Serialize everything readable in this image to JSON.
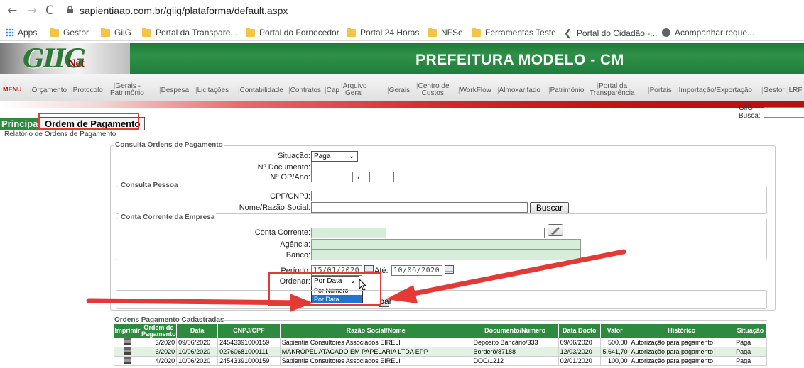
{
  "browser": {
    "url": "sapientiaap.com.br/giig/plataforma/default.aspx",
    "bookmarks": [
      "Apps",
      "Gestor",
      "GiiG",
      "Portal da Transpare...",
      "Portal do Fornecedor",
      "Portal 24 Horas",
      "NFSe",
      "Ferramentas Teste",
      "Portal do Cidadão -...",
      "Acompanhar reque..."
    ]
  },
  "header": {
    "logo_main": "GIIG",
    "logo_sub": "Net",
    "title": "PREFEITURA MODELO - CM"
  },
  "menu": {
    "label": "MENU",
    "items": [
      "Orçamento",
      "Protocolo",
      "Gerais -",
      "Patrimônio",
      "Despesa",
      "Licitações",
      "Contabilidade",
      "Contratos",
      "Cap",
      "Arquivo",
      "Geral",
      "Gerais",
      "Centro de",
      "Custos",
      "WorkFlow",
      "Almoxarifado",
      "Patrimônio",
      "Portal da",
      "Transparência",
      "Portais",
      "Importação/Exportação",
      "Gestor",
      "LRF"
    ]
  },
  "search": {
    "label": "GiiG Busca:"
  },
  "tabs": {
    "principal": "Principal",
    "ordem": "Ordem de Pagamento"
  },
  "subtitle": "Relatório de Ordens de Pagamento",
  "consulta": {
    "legend": "Consulta Ordens de Pagamento",
    "situacao_label": "Situação:",
    "situacao_value": "Paga",
    "documento_label": "Nº Documento:",
    "op_label": "Nº OP/Ano:",
    "op_sep": "/"
  },
  "pessoa": {
    "legend": "Consulta Pessoa",
    "cpf_label": "CPF/CNPJ:",
    "nome_label": "Nome/Razão Social:",
    "buscar": "Buscar"
  },
  "conta": {
    "legend": "Conta Corrente da Empresa",
    "conta_label": "Conta Corrente:",
    "agencia_label": "Agência:",
    "banco_label": "Banco:"
  },
  "periodo": {
    "label": "Período:",
    "inicio": "15/01/2020",
    "ate_label": "Até:",
    "fim": "10/06/2020"
  },
  "ordenar": {
    "label": "Ordenar:",
    "value": "Por Data",
    "options": [
      "Por Número",
      "Por Data"
    ]
  },
  "limpar": "Limpar",
  "grid": {
    "legend": "Ordens Pagamento Cadastradas",
    "headers": [
      "Imprimir",
      "Ordem de Pagamento",
      "Data",
      "CNPJ/CPF",
      "Razão Social/Nome",
      "Documento/Número",
      "Data Docto",
      "Valor",
      "Histórico",
      "Situação"
    ],
    "rows": [
      [
        "3/2020",
        "09/06/2020",
        "24543391000159",
        "Sapientia Consultores Associados EIRELI",
        "Depósito Bancário/333",
        "09/06/2020",
        "500,00",
        "Autorização para pagamento",
        "Paga"
      ],
      [
        "6/2020",
        "10/06/2020",
        "02760681000111",
        "MAKROPEL ATACADO EM PAPELARIA LTDA EPP",
        "Borderô/87188",
        "12/03/2020",
        "5.641,70",
        "Autorização para pagamento",
        "Paga"
      ],
      [
        "4/2020",
        "10/06/2020",
        "24543391000159",
        "Sapientia Consultores Associados EIRELI",
        "DOC/1212",
        "02/01/2020",
        "100,00",
        "Autorização para pagamento",
        "Paga"
      ]
    ]
  }
}
